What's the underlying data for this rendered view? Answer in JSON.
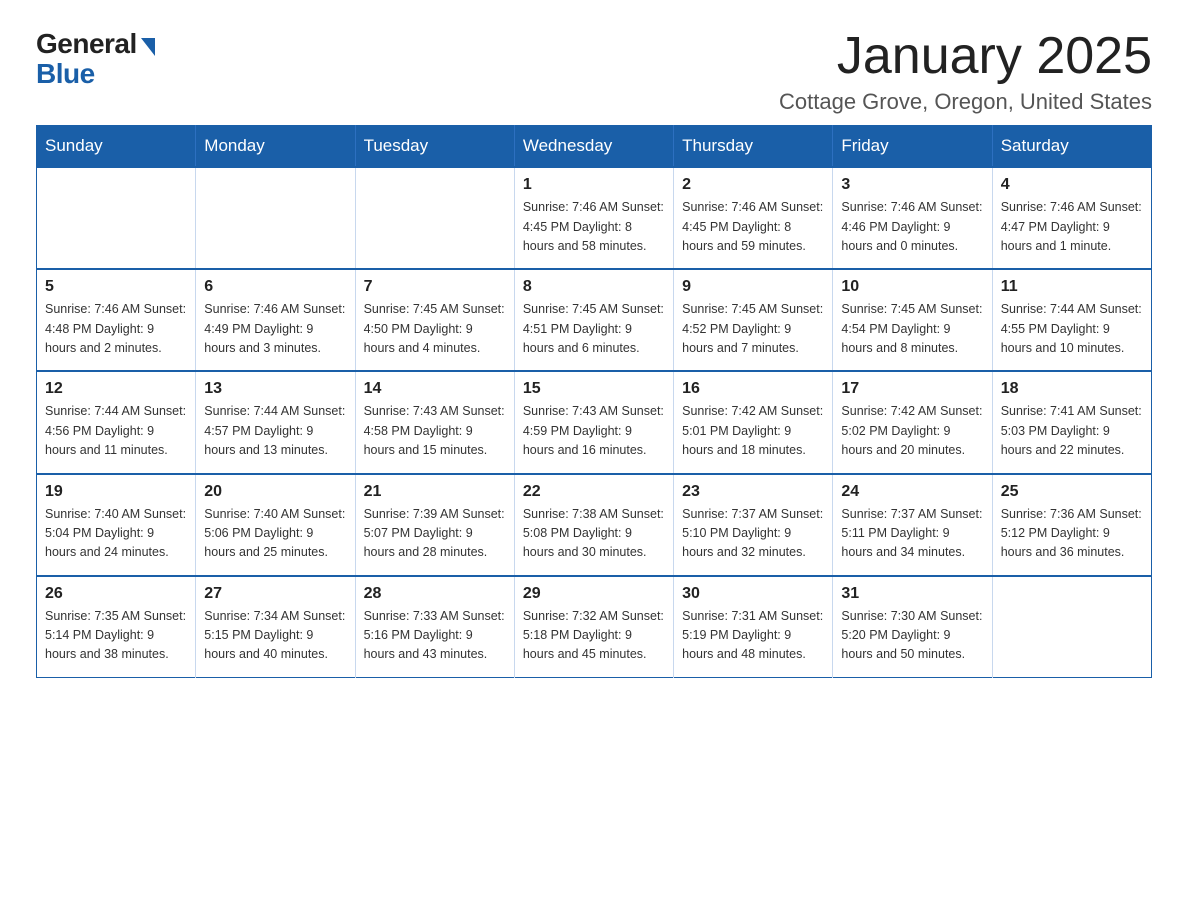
{
  "logo": {
    "general": "General",
    "blue": "Blue"
  },
  "title": "January 2025",
  "location": "Cottage Grove, Oregon, United States",
  "days_of_week": [
    "Sunday",
    "Monday",
    "Tuesday",
    "Wednesday",
    "Thursday",
    "Friday",
    "Saturday"
  ],
  "weeks": [
    [
      {
        "day": "",
        "info": ""
      },
      {
        "day": "",
        "info": ""
      },
      {
        "day": "",
        "info": ""
      },
      {
        "day": "1",
        "info": "Sunrise: 7:46 AM\nSunset: 4:45 PM\nDaylight: 8 hours\nand 58 minutes."
      },
      {
        "day": "2",
        "info": "Sunrise: 7:46 AM\nSunset: 4:45 PM\nDaylight: 8 hours\nand 59 minutes."
      },
      {
        "day": "3",
        "info": "Sunrise: 7:46 AM\nSunset: 4:46 PM\nDaylight: 9 hours\nand 0 minutes."
      },
      {
        "day": "4",
        "info": "Sunrise: 7:46 AM\nSunset: 4:47 PM\nDaylight: 9 hours\nand 1 minute."
      }
    ],
    [
      {
        "day": "5",
        "info": "Sunrise: 7:46 AM\nSunset: 4:48 PM\nDaylight: 9 hours\nand 2 minutes."
      },
      {
        "day": "6",
        "info": "Sunrise: 7:46 AM\nSunset: 4:49 PM\nDaylight: 9 hours\nand 3 minutes."
      },
      {
        "day": "7",
        "info": "Sunrise: 7:45 AM\nSunset: 4:50 PM\nDaylight: 9 hours\nand 4 minutes."
      },
      {
        "day": "8",
        "info": "Sunrise: 7:45 AM\nSunset: 4:51 PM\nDaylight: 9 hours\nand 6 minutes."
      },
      {
        "day": "9",
        "info": "Sunrise: 7:45 AM\nSunset: 4:52 PM\nDaylight: 9 hours\nand 7 minutes."
      },
      {
        "day": "10",
        "info": "Sunrise: 7:45 AM\nSunset: 4:54 PM\nDaylight: 9 hours\nand 8 minutes."
      },
      {
        "day": "11",
        "info": "Sunrise: 7:44 AM\nSunset: 4:55 PM\nDaylight: 9 hours\nand 10 minutes."
      }
    ],
    [
      {
        "day": "12",
        "info": "Sunrise: 7:44 AM\nSunset: 4:56 PM\nDaylight: 9 hours\nand 11 minutes."
      },
      {
        "day": "13",
        "info": "Sunrise: 7:44 AM\nSunset: 4:57 PM\nDaylight: 9 hours\nand 13 minutes."
      },
      {
        "day": "14",
        "info": "Sunrise: 7:43 AM\nSunset: 4:58 PM\nDaylight: 9 hours\nand 15 minutes."
      },
      {
        "day": "15",
        "info": "Sunrise: 7:43 AM\nSunset: 4:59 PM\nDaylight: 9 hours\nand 16 minutes."
      },
      {
        "day": "16",
        "info": "Sunrise: 7:42 AM\nSunset: 5:01 PM\nDaylight: 9 hours\nand 18 minutes."
      },
      {
        "day": "17",
        "info": "Sunrise: 7:42 AM\nSunset: 5:02 PM\nDaylight: 9 hours\nand 20 minutes."
      },
      {
        "day": "18",
        "info": "Sunrise: 7:41 AM\nSunset: 5:03 PM\nDaylight: 9 hours\nand 22 minutes."
      }
    ],
    [
      {
        "day": "19",
        "info": "Sunrise: 7:40 AM\nSunset: 5:04 PM\nDaylight: 9 hours\nand 24 minutes."
      },
      {
        "day": "20",
        "info": "Sunrise: 7:40 AM\nSunset: 5:06 PM\nDaylight: 9 hours\nand 25 minutes."
      },
      {
        "day": "21",
        "info": "Sunrise: 7:39 AM\nSunset: 5:07 PM\nDaylight: 9 hours\nand 28 minutes."
      },
      {
        "day": "22",
        "info": "Sunrise: 7:38 AM\nSunset: 5:08 PM\nDaylight: 9 hours\nand 30 minutes."
      },
      {
        "day": "23",
        "info": "Sunrise: 7:37 AM\nSunset: 5:10 PM\nDaylight: 9 hours\nand 32 minutes."
      },
      {
        "day": "24",
        "info": "Sunrise: 7:37 AM\nSunset: 5:11 PM\nDaylight: 9 hours\nand 34 minutes."
      },
      {
        "day": "25",
        "info": "Sunrise: 7:36 AM\nSunset: 5:12 PM\nDaylight: 9 hours\nand 36 minutes."
      }
    ],
    [
      {
        "day": "26",
        "info": "Sunrise: 7:35 AM\nSunset: 5:14 PM\nDaylight: 9 hours\nand 38 minutes."
      },
      {
        "day": "27",
        "info": "Sunrise: 7:34 AM\nSunset: 5:15 PM\nDaylight: 9 hours\nand 40 minutes."
      },
      {
        "day": "28",
        "info": "Sunrise: 7:33 AM\nSunset: 5:16 PM\nDaylight: 9 hours\nand 43 minutes."
      },
      {
        "day": "29",
        "info": "Sunrise: 7:32 AM\nSunset: 5:18 PM\nDaylight: 9 hours\nand 45 minutes."
      },
      {
        "day": "30",
        "info": "Sunrise: 7:31 AM\nSunset: 5:19 PM\nDaylight: 9 hours\nand 48 minutes."
      },
      {
        "day": "31",
        "info": "Sunrise: 7:30 AM\nSunset: 5:20 PM\nDaylight: 9 hours\nand 50 minutes."
      },
      {
        "day": "",
        "info": ""
      }
    ]
  ]
}
